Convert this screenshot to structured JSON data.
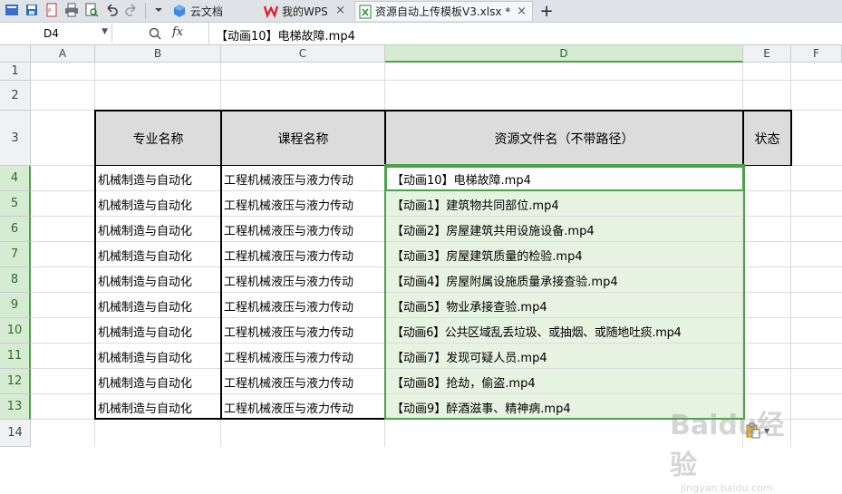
{
  "titlebar": {
    "tabs": [
      {
        "label": "云文档"
      },
      {
        "label": "我的WPS"
      },
      {
        "label": "资源自动上传模板V3.xlsx *"
      }
    ],
    "new_tab": "+",
    "close": "×"
  },
  "formula_bar": {
    "cell_ref": "D4",
    "fx": "fx",
    "content": "【动画10】电梯故障.mp4"
  },
  "columns": [
    "A",
    "B",
    "C",
    "D",
    "E",
    "F"
  ],
  "rows": [
    "1",
    "2",
    "3",
    "4",
    "5",
    "6",
    "7",
    "8",
    "9",
    "10",
    "11",
    "12",
    "13",
    "14"
  ],
  "table": {
    "headers": [
      "专业名称",
      "课程名称",
      "资源文件名（不带路径）",
      "状态"
    ],
    "rows": [
      [
        "机械制造与自动化",
        "工程机械液压与液力传动",
        "【动画10】电梯故障.mp4",
        ""
      ],
      [
        "机械制造与自动化",
        "工程机械液压与液力传动",
        "【动画1】建筑物共同部位.mp4",
        ""
      ],
      [
        "机械制造与自动化",
        "工程机械液压与液力传动",
        "【动画2】房屋建筑共用设施设备.mp4",
        ""
      ],
      [
        "机械制造与自动化",
        "工程机械液压与液力传动",
        "【动画3】房屋建筑质量的检验.mp4",
        ""
      ],
      [
        "机械制造与自动化",
        "工程机械液压与液力传动",
        "【动画4】房屋附属设施质量承接查验.mp4",
        ""
      ],
      [
        "机械制造与自动化",
        "工程机械液压与液力传动",
        "【动画5】物业承接查验.mp4",
        ""
      ],
      [
        "机械制造与自动化",
        "工程机械液压与液力传动",
        "【动画6】公共区域乱丢垃圾、或抽烟、或随地吐痰.mp4",
        ""
      ],
      [
        "机械制造与自动化",
        "工程机械液压与液力传动",
        "【动画7】发现可疑人员.mp4",
        ""
      ],
      [
        "机械制造与自动化",
        "工程机械液压与液力传动",
        "【动画8】抢劫，偷盗.mp4",
        ""
      ],
      [
        "机械制造与自动化",
        "工程机械液压与液力传动",
        "【动画9】醉酒滋事、精神病.mp4",
        ""
      ]
    ]
  },
  "watermark": {
    "line1": "Baidu经验",
    "line2": "jingyan.baidu.com"
  },
  "colors": {
    "selection": "#4ca24a",
    "selection_fill": "#e6f3e1",
    "header_fill": "#dcdcdc"
  }
}
